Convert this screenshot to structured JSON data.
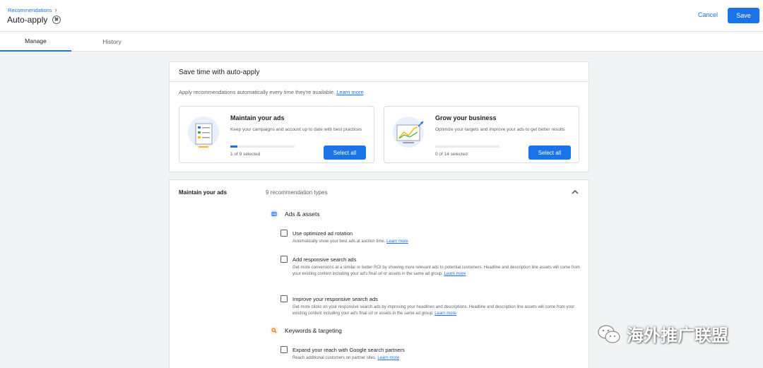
{
  "header": {
    "breadcrumb": "Recommendations",
    "title": "Auto-apply",
    "cancel_label": "Cancel",
    "save_label": "Save"
  },
  "tabs": [
    {
      "label": "Manage",
      "active": true
    },
    {
      "label": "History",
      "active": false
    }
  ],
  "autoapply_card": {
    "title": "Save time with auto-apply",
    "intro": "Apply recommendations automatically every time they're available.",
    "learn_more": "Learn more",
    "options": [
      {
        "title": "Maintain your ads",
        "description": "Keep your campaigns and account up to date with best practices",
        "selected_text": "1 of 9 selected",
        "progress": 0.11,
        "button": "Select all"
      },
      {
        "title": "Grow your business",
        "description": "Optimize your targets and improve your ads to get better results",
        "selected_text": "0 of 14 selected",
        "progress": 0,
        "button": "Select all"
      }
    ]
  },
  "maintain_section": {
    "label": "Maintain your ads",
    "count": "9 recommendation types",
    "groups": [
      {
        "title": "Ads & assets",
        "icon": "ads-assets-icon",
        "items": [
          {
            "title": "Use optimized ad rotation",
            "description": "Automatically show your best ads at auction time.",
            "learn_more": "Learn more",
            "checked": false
          },
          {
            "title": "Add responsive search ads",
            "description": "Get more conversions at a similar or better ROI by showing more relevant ads to potential customers. Headline and description line assets will come from your existing content including your ad's final url or assets in the same ad group.",
            "learn_more": "Learn more",
            "checked": false
          },
          {
            "title": "Improve your responsive search ads",
            "description": "Get more clicks on your responsive search ads by improving your headlines and descriptions. Headline and description line assets will come from your existing content including your ad's final url or assets in the same ad group.",
            "learn_more": "Learn more",
            "checked": false
          }
        ]
      },
      {
        "title": "Keywords & targeting",
        "icon": "search-icon",
        "items": [
          {
            "title": "Expand your reach with Google search partners",
            "description": "Reach additional customers on partner sites.",
            "learn_more": "Learn more",
            "checked": false
          }
        ]
      }
    ]
  },
  "watermark": {
    "text": "海外推广联盟"
  },
  "colors": {
    "accent": "#1a73e8",
    "background": "#f1f3f4"
  }
}
